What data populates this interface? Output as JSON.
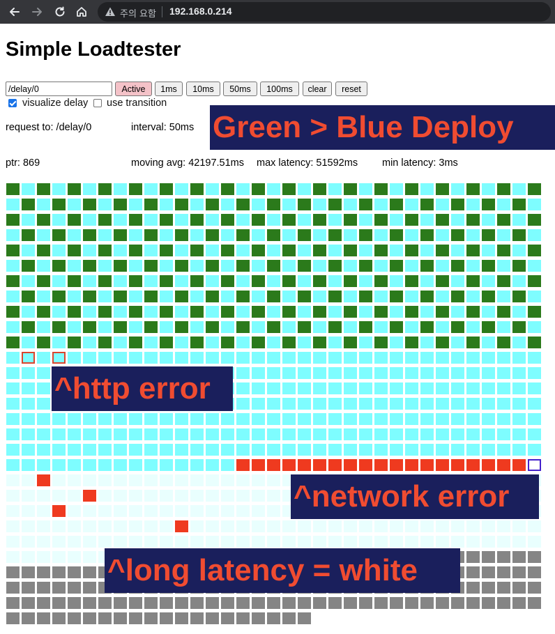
{
  "browser": {
    "security_warning": "주의 요함",
    "url": "192.168.0.214",
    "icons": [
      "back-arrow-icon",
      "forward-arrow-icon",
      "reload-icon",
      "home-icon",
      "warning-icon"
    ]
  },
  "page": {
    "title": "Simple Loadtester"
  },
  "controls": {
    "path_value": "/delay/0",
    "buttons": {
      "active": "Active",
      "b1ms": "1ms",
      "b10ms": "10ms",
      "b50ms": "50ms",
      "b100ms": "100ms",
      "clear": "clear",
      "reset": "reset"
    },
    "visualize_delay_label": "visualize delay",
    "use_transition_label": "use transition",
    "visualize_delay_checked": true,
    "use_transition_checked": false
  },
  "info": {
    "request_to": "request to: /delay/0",
    "interval": "interval: 50ms",
    "ptr": "ptr: 869",
    "moving_avg": "moving avg: 42197.51ms",
    "max_latency": "max latency: 51592ms",
    "min_latency": "min latency: 3ms"
  },
  "annotations": {
    "deploy": "Green > Blue Deploy",
    "http_error": "^http error",
    "network_error": "^network error",
    "long_latency": "^long latency = white"
  },
  "colors": {
    "green_response": "#2b7a1b",
    "blue_response": "#7efdff",
    "error": "#ef3a1f",
    "long_latency": "#e9fffe",
    "pending": "#858585",
    "pointer_border": "#4422cc",
    "annotation_bg": "#1a1f5c",
    "annotation_text": "#f04c31",
    "active_button": "#f4c2c8"
  },
  "grid": {
    "columns": 35,
    "legend": {
      "g": "green deployment response",
      "b": "blue deployment response",
      "r": "error",
      "w": "long latency",
      "x": "pending",
      "k": "in-flight request"
    },
    "rows": [
      "gbgbgbgbgbgbgbgbgbgbgbgbgbgbgbgbgbg",
      "bgbgbgbgbgbgbgbgbgbgbgbgbgbgbgbgbgb",
      "gbgbgbgbgbgbgbgbgbgbgbgbgbgbgbgbgbg",
      "bgbgbgbgbgbgbgbgbgbgbgbgbgbgbgbgbgb",
      "gbgbgbgbgbgbgbgbgbgbgbgbgbgbgbgbgbg",
      "bgbgbgbgbgbgbgbgbgbgbgbgbgbgbgbgbgb",
      "gbgbgbgbgbgbgbgbgbgbgbgbgbgbgbgbgbg",
      "bgbgbgbgbgbgbgbgbgbgbgbgbgbgbgbgbgb",
      "gbgbgbgbgbgbgbgbgbgbgbgbgbgbgbgbgbg",
      "bgbgbgbgbgbgbgbgbgbgbgbgbgbgbgbgbgb",
      "gbgbgbgbgbgbgbgbgbgbgbgbgbgbgbgbgbg",
      "bebebbbbbbbbbbbbbbbbbbbbbbbbbbbbbbb",
      "bbbbbbbbbbbbbbbbbbbbbbbbbbbbbbbbbbb",
      "bbbbbbbbbbbbbbbbbbbbbbbbbbbbbbbbbbb",
      "bbbbbbbbbbbbbbbbbbbbbbbbbbbbbbbbbbb",
      "bbbbbbbbbbbbbbbbbbbbbbbbbbbbbbbbbbb",
      "bbbbbbbbbbbbbbbbbbbbbbbbbbbbbbbbbbb",
      "bbbbbbbbbbbbbbbbbbbbbbbbbbbbbbbbbbb",
      "bbbbbbbbbbbbbbbrrrrrrrrrrrrrrrrrrrp",
      "wwrwwwwwwwwwwwwwwwwwwwwwwwwwwwwwwww",
      "wwwwwrwwwwwwwwwwwwwwwwwwwwwwwwwwwww",
      "wwwrwwwwwwwwwwwwwwwwwwwwwwwwwwwwwww",
      "wwwwwwwwwwwrwwwwwwwwwwwwwwwwwwwwwww",
      "wwwwwwwwwwwwwwwwwwwwwwwwwwwwwwwwwww",
      "wwwwwwwwwwwwwwwwwwwwwwwwwwwkxxxxxxx",
      "xxxxxxxxxxxxxxxxxxxxxxxxxxxxxxxxxxx",
      "xxxxxxxxxxxxxxxxxxxxxxxxxxxxxxxxxxx",
      "xxxxxxxxxxxxxxxxxxxxxxxxxxxxxxxxxxx",
      "xxxxxxxxxxxxxxxxxxxx"
    ]
  }
}
